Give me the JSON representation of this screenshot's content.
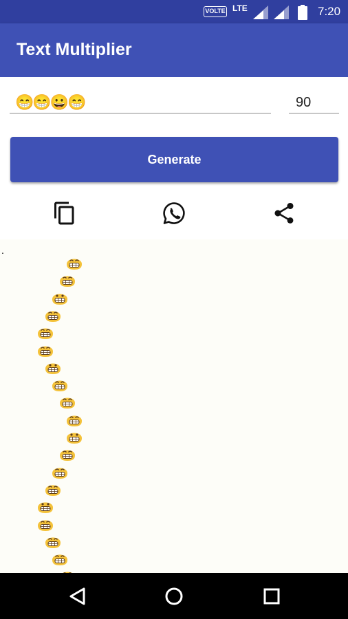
{
  "status_bar": {
    "volte_label": "VOLTE",
    "network_label": "LTE",
    "time": "7:20",
    "icons": [
      "signal-icon",
      "signal-icon",
      "battery-icon"
    ]
  },
  "app_bar": {
    "title": "Text Multiplier"
  },
  "input": {
    "text_value": "😁😁😀😁",
    "count_value": "90"
  },
  "generate_button": {
    "label": "Generate"
  },
  "actions": {
    "icons": [
      "copy-icon",
      "whatsapp-icon",
      "share-icon"
    ]
  },
  "output": {
    "leading_text": ".",
    "emoji_sequence": [
      "😁",
      "😁",
      "😀",
      "😁",
      "😁",
      "😁",
      "😀",
      "😁",
      "😁",
      "😁",
      "😀",
      "😁",
      "😁",
      "😁",
      "😀",
      "😁",
      "😁",
      "😁",
      "😁"
    ]
  },
  "nav_bar": {
    "icons": [
      "back-icon",
      "home-icon",
      "recents-icon"
    ]
  },
  "colors": {
    "primary": "#3f51b5",
    "primary_dark": "#303f9f",
    "emoji_yellow": "#f4c23a"
  }
}
